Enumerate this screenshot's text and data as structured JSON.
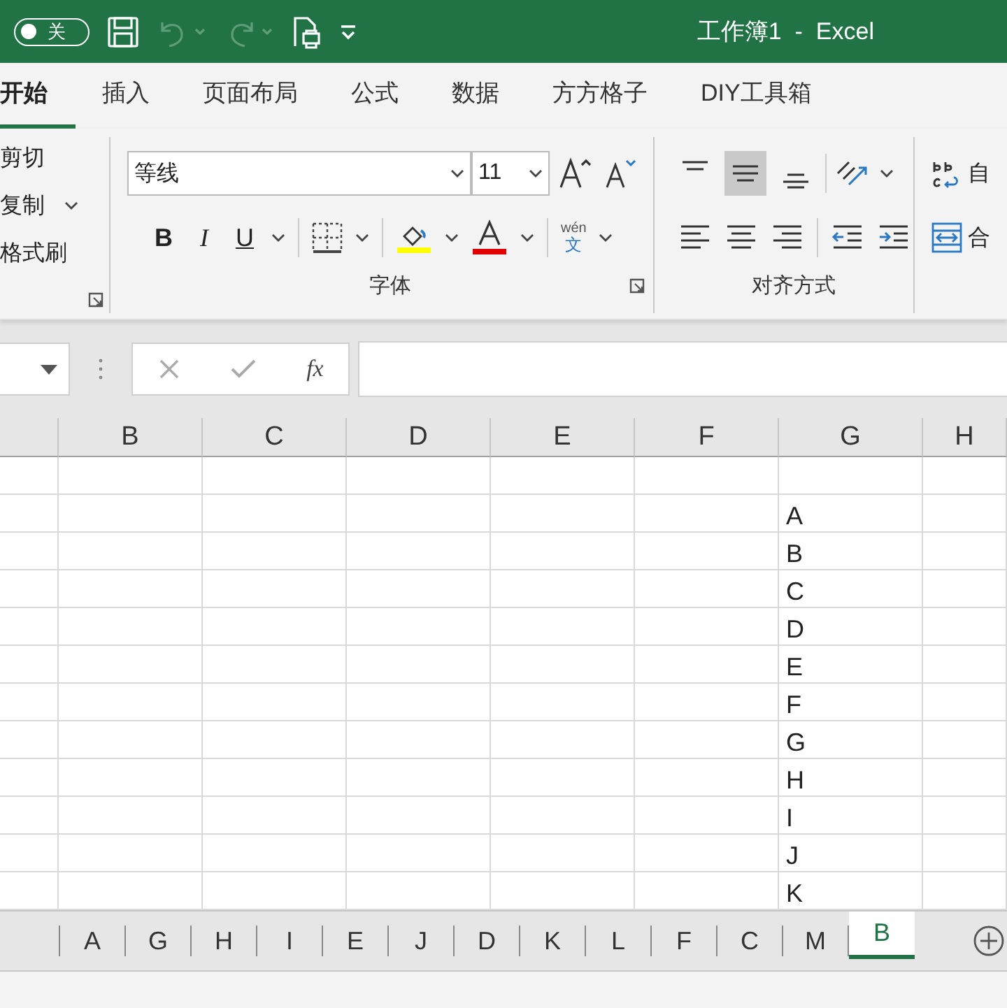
{
  "title_bar": {
    "autosave": {
      "label": "关",
      "on": false
    },
    "title": "工作簿1  -  Excel"
  },
  "quick_access": [
    {
      "kind": "save",
      "disabled": false
    },
    {
      "kind": "undo",
      "disabled": true
    },
    {
      "kind": "redo",
      "disabled": true
    },
    {
      "kind": "preview",
      "disabled": false
    },
    {
      "kind": "customize",
      "disabled": false
    }
  ],
  "ribbon_tabs": [
    {
      "label": "开始",
      "selected": true
    },
    {
      "label": "插入",
      "selected": false
    },
    {
      "label": "页面布局",
      "selected": false
    },
    {
      "label": "公式",
      "selected": false
    },
    {
      "label": "数据",
      "selected": false
    },
    {
      "label": "方方格子",
      "selected": false
    },
    {
      "label": "DIY工具箱",
      "selected": false
    }
  ],
  "clipboard": {
    "items": [
      {
        "label": "剪切",
        "dropdown": false
      },
      {
        "label": "复制",
        "dropdown": true
      },
      {
        "label": "格式刷",
        "dropdown": false
      }
    ]
  },
  "font": {
    "font_name": "等线",
    "font_size": "11",
    "bold": "B",
    "italic": "I",
    "underline": "U",
    "phonetic_top": "wén",
    "phonetic_bottom": "文",
    "label": "字体"
  },
  "alignment": {
    "vertical": [
      {
        "kind": "top",
        "selected": false
      },
      {
        "kind": "middle",
        "selected": true
      },
      {
        "kind": "bottom",
        "selected": false
      }
    ],
    "label": "对齐方式"
  },
  "extra": {
    "wrap_label": "自",
    "merge_label": "合"
  },
  "formula_bar": {
    "function_label": "fx"
  },
  "sheet": {
    "columns": [
      "B",
      "C",
      "D",
      "E",
      "F",
      "G",
      "H"
    ],
    "rows": [
      {},
      {
        "G": "A"
      },
      {
        "G": "B"
      },
      {
        "G": "C"
      },
      {
        "G": "D"
      },
      {
        "G": "E"
      },
      {
        "G": "F"
      },
      {
        "G": "G"
      },
      {
        "G": "H"
      },
      {
        "G": "I"
      },
      {
        "G": "J"
      },
      {
        "G": "K"
      }
    ]
  },
  "sheet_tabs": [
    {
      "label": "A",
      "selected": false
    },
    {
      "label": "G",
      "selected": false
    },
    {
      "label": "H",
      "selected": false
    },
    {
      "label": "I",
      "selected": false
    },
    {
      "label": "E",
      "selected": false
    },
    {
      "label": "J",
      "selected": false
    },
    {
      "label": "D",
      "selected": false
    },
    {
      "label": "K",
      "selected": false
    },
    {
      "label": "L",
      "selected": false
    },
    {
      "label": "F",
      "selected": false
    },
    {
      "label": "C",
      "selected": false
    },
    {
      "label": "M",
      "selected": false
    },
    {
      "label": "B",
      "selected": true
    }
  ]
}
